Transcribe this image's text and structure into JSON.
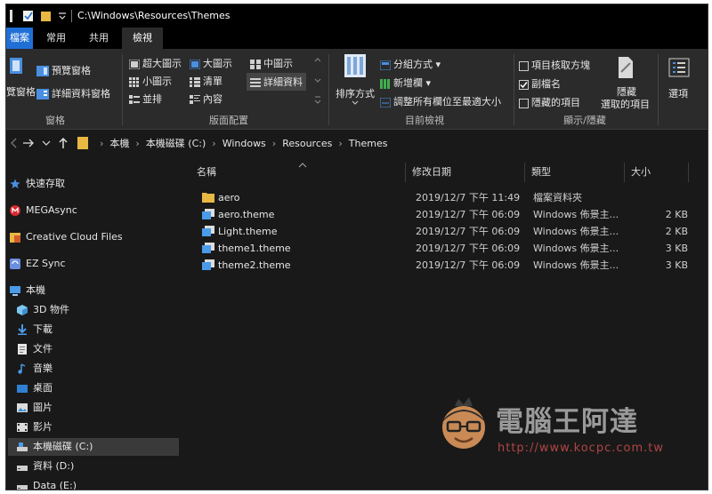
{
  "window": {
    "title": "C:\\Windows\\Resources\\Themes"
  },
  "tabs": {
    "file": "檔案",
    "home": "常用",
    "share": "共用",
    "view": "檢視"
  },
  "ribbon": {
    "panes": {
      "nav_pane": "覽窗格",
      "preview_pane": "預覽窗格",
      "details_pane": "詳細資料窗格",
      "label": "窗格"
    },
    "layout": {
      "extra_large": "超大圖示",
      "large": "大圖示",
      "medium": "中圖示",
      "small": "小圖示",
      "list": "清單",
      "details": "詳細資料",
      "tiles": "並排",
      "content": "內容",
      "label": "版面配置"
    },
    "current_view": {
      "sort_by": "排序方式",
      "group_by": "分組方式",
      "add_columns": "新增欄",
      "size_all_columns": "調整所有欄位至最適大小",
      "label": "目前檢視"
    },
    "show_hide": {
      "item_checkboxes": "項目核取方塊",
      "file_name_extensions": "副檔名",
      "hidden_items": "隱藏的項目",
      "hide_selected_1": "隱藏",
      "hide_selected_2": "選取的項目",
      "label": "顯示/隱藏",
      "ext_checked": true
    },
    "options": "選項"
  },
  "address": {
    "crumbs": [
      "本機",
      "本機磁碟 (C:)",
      "Windows",
      "Resources",
      "Themes"
    ]
  },
  "nav": {
    "items": [
      {
        "label": "快速存取",
        "icon": "star-icon"
      },
      {
        "label": "MEGAsync",
        "icon": "mega-icon"
      },
      {
        "label": "Creative Cloud Files",
        "icon": "creative-cloud-icon"
      },
      {
        "label": "EZ Sync",
        "icon": "ez-sync-icon"
      },
      {
        "label": "本機",
        "icon": "computer-icon"
      },
      {
        "label": "3D 物件",
        "icon": "cube-icon"
      },
      {
        "label": "下載",
        "icon": "download-icon"
      },
      {
        "label": "文件",
        "icon": "document-icon"
      },
      {
        "label": "音樂",
        "icon": "music-icon"
      },
      {
        "label": "桌面",
        "icon": "desktop-icon"
      },
      {
        "label": "圖片",
        "icon": "pictures-icon"
      },
      {
        "label": "影片",
        "icon": "video-icon"
      },
      {
        "label": "本機磁碟 (C:)",
        "icon": "drive-icon"
      },
      {
        "label": "資料 (D:)",
        "icon": "drive-icon"
      },
      {
        "label": "Data (E:)",
        "icon": "drive-icon"
      }
    ]
  },
  "list": {
    "columns": {
      "name": "名稱",
      "modified": "修改日期",
      "type": "類型",
      "size": "大小"
    },
    "rows": [
      {
        "name": "aero",
        "modified": "2019/12/7 下午 11:49",
        "type": "檔案資料夾",
        "size": "",
        "icon": "folder-icon"
      },
      {
        "name": "aero.theme",
        "modified": "2019/12/7 下午 06:09",
        "type": "Windows 佈景主...",
        "size": "2 KB",
        "icon": "theme-file-icon"
      },
      {
        "name": "Light.theme",
        "modified": "2019/12/7 下午 06:09",
        "type": "Windows 佈景主...",
        "size": "2 KB",
        "icon": "theme-file-icon"
      },
      {
        "name": "theme1.theme",
        "modified": "2019/12/7 下午 06:09",
        "type": "Windows 佈景主...",
        "size": "3 KB",
        "icon": "theme-file-icon"
      },
      {
        "name": "theme2.theme",
        "modified": "2019/12/7 下午 06:09",
        "type": "Windows 佈景主...",
        "size": "3 KB",
        "icon": "theme-file-icon"
      }
    ]
  },
  "watermark": {
    "brand": "電腦王阿達",
    "url": "http://www.kocpc.com.tw"
  },
  "colors": {
    "accent": "#1f6fd6",
    "folder": "#e8b843",
    "background": "#191919",
    "ribbon": "#2b2b2b"
  }
}
